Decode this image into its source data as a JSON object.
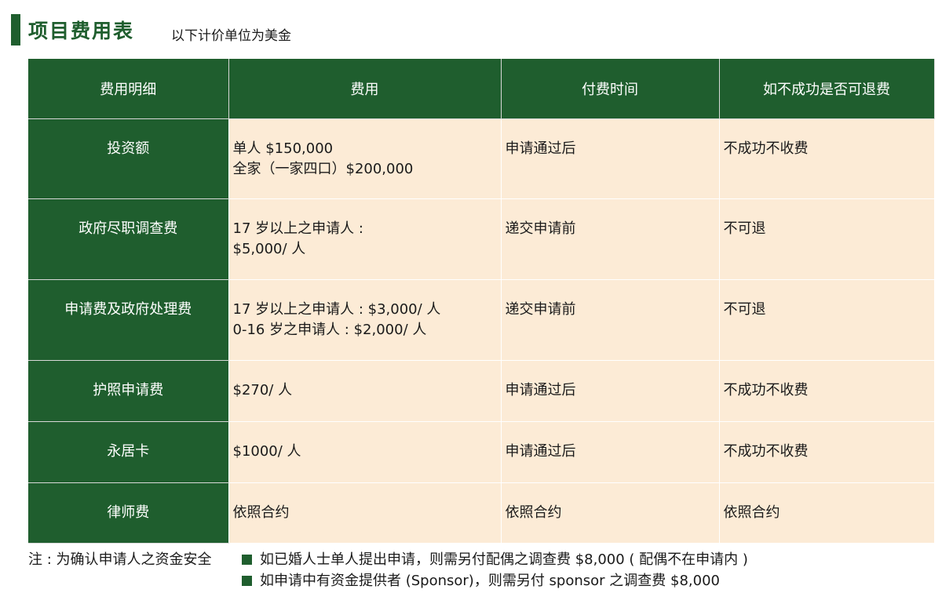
{
  "header": {
    "title": "项目费用表",
    "subtitle": "以下计价单位为美金"
  },
  "table": {
    "headers": [
      "费用明细",
      "费用",
      "付费时间",
      "如不成功是否可退费"
    ],
    "rows": [
      {
        "item": "投资额",
        "fee_lines": [
          "单人 $150,000",
          "全家（一家四口）$200,000"
        ],
        "time": "申请通过后",
        "refund": "不成功不收费"
      },
      {
        "item": "政府尽职调查费",
        "fee_lines": [
          "17 岁以上之申请人 :",
          "$5,000/ 人"
        ],
        "time": "递交申请前",
        "refund": "不可退"
      },
      {
        "item": "申请费及政府处理费",
        "fee_lines": [
          "17 岁以上之申请人 : $3,000/ 人",
          "0-16 岁之申请人 : $2,000/ 人"
        ],
        "time": "递交申请前",
        "refund": "不可退"
      },
      {
        "item": "护照申请费",
        "fee_lines": [
          "$270/ 人"
        ],
        "time": "申请通过后",
        "refund": "不成功不收费"
      },
      {
        "item": "永居卡",
        "fee_lines": [
          "$1000/ 人"
        ],
        "time": "申请通过后",
        "refund": "不成功不收费"
      },
      {
        "item": "律师费",
        "fee_lines": [
          "依照合约"
        ],
        "time": "依照合约",
        "refund": "依照合约"
      }
    ]
  },
  "notes": {
    "label": "注 : 为确认申请人之资金安全",
    "items": [
      "如已婚人士单人提出申请，则需另付配偶之调查费 $8,000 ( 配偶不在申请内 )",
      "如申请中有资金提供者 (Sponsor)，则需另付 sponsor 之调查费 $8,000"
    ]
  },
  "colors": {
    "header_green": "#1f5e2e",
    "cell_beige": "#fcebd6"
  }
}
